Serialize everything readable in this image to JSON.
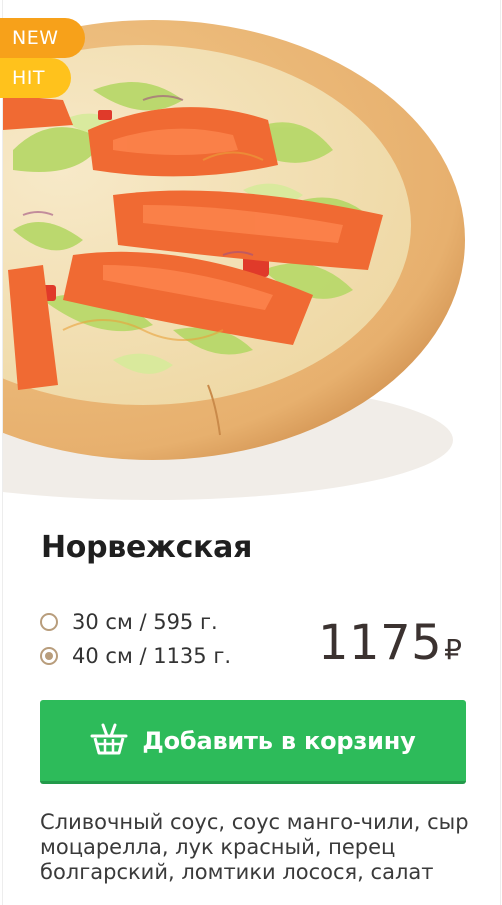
{
  "product": {
    "badges": [
      "NEW",
      "HIT"
    ],
    "image_alt": "pizza-photo",
    "title": "Норвежская",
    "sizes": [
      {
        "label": "30 см / 595 г.",
        "selected": false
      },
      {
        "label": "40 см / 1135 г.",
        "selected": true
      }
    ],
    "price": "1175",
    "currency": "₽",
    "add_to_cart_label": "Добавить в корзину",
    "description": "Сливочный соус, соус манго-чили, сыр моцарелла, лук красный, перец болгарский, ломтики лосося, салат"
  },
  "colors": {
    "badge_new": "#f7a11a",
    "badge_hit": "#ffc21c",
    "button": "#2dbb5a",
    "radio": "#b89d7c",
    "price": "#3b3230"
  },
  "icons": {
    "cart": "basket-icon"
  }
}
